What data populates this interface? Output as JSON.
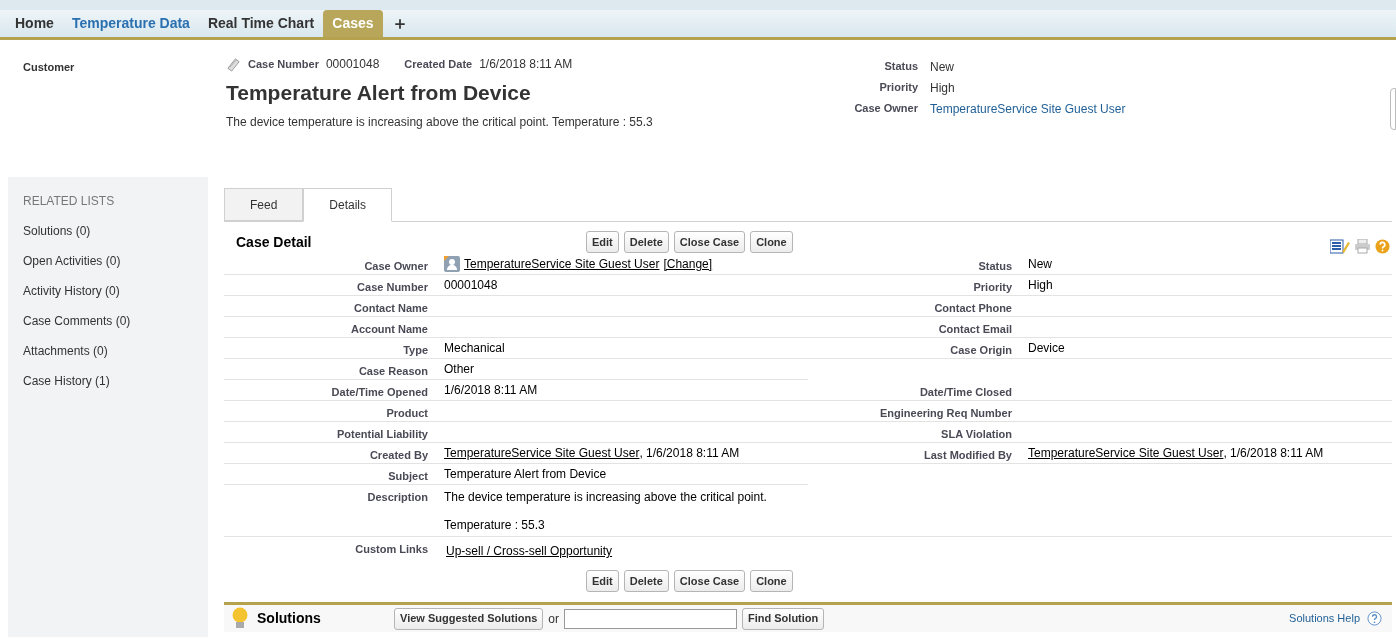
{
  "tabs": [
    {
      "kind": "text",
      "label": "Home",
      "selected": false,
      "hovered": false
    },
    {
      "kind": "text",
      "label": "Temperature Data",
      "selected": false,
      "hovered": true
    },
    {
      "kind": "text",
      "label": "Real Time Chart",
      "selected": false,
      "hovered": false
    },
    {
      "kind": "text",
      "label": "Cases",
      "selected": true,
      "hovered": false
    },
    {
      "kind": "add",
      "selected": false
    }
  ],
  "header": {
    "left_label": "Customer",
    "meta": [
      {
        "label": "Case Number",
        "value": "00001048"
      },
      {
        "label": "Created Date",
        "value": "1/6/2018 8:11 AM"
      }
    ],
    "title": "Temperature Alert from Device",
    "description": "The device temperature is increasing above the critical point. Temperature : 55.3",
    "fields": [
      {
        "label": "Status",
        "value": "New",
        "link": false
      },
      {
        "label": "Priority",
        "value": "High",
        "link": false
      },
      {
        "label": "Case Owner",
        "value": "TemperatureService Site Guest User",
        "link": true
      }
    ]
  },
  "sidebar": {
    "title": "RELATED LISTS",
    "items": [
      "Solutions (0)",
      "Open Activities (0)",
      "Activity History (0)",
      "Case Comments (0)",
      "Attachments (0)",
      "Case History (1)"
    ]
  },
  "view_tabs": [
    {
      "label": "Feed",
      "selected": false
    },
    {
      "label": "Details",
      "selected": true
    }
  ],
  "detail": {
    "title": "Case Detail",
    "top_buttons": [
      "Edit",
      "Delete",
      "Close Case",
      "Clone"
    ],
    "rows": [
      {
        "left": {
          "label": "Case Owner",
          "parts": [
            {
              "kind": "avatar"
            },
            {
              "kind": "link",
              "text": "TemperatureService Site Guest User"
            },
            {
              "kind": "link",
              "text": "[Change]"
            }
          ]
        },
        "right": {
          "label": "Status",
          "parts": [
            {
              "kind": "text",
              "text": "New"
            }
          ]
        }
      },
      {
        "left": {
          "label": "Case Number",
          "parts": [
            {
              "kind": "text",
              "text": "00001048"
            }
          ]
        },
        "right": {
          "label": "Priority",
          "parts": [
            {
              "kind": "text",
              "text": "High"
            }
          ]
        }
      },
      {
        "left": {
          "label": "Contact Name"
        },
        "right": {
          "label": "Contact Phone"
        }
      },
      {
        "left": {
          "label": "Account Name"
        },
        "right": {
          "label": "Contact Email"
        }
      },
      {
        "left": {
          "label": "Type",
          "parts": [
            {
              "kind": "text",
              "text": "Mechanical"
            }
          ]
        },
        "right": {
          "label": "Case Origin",
          "parts": [
            {
              "kind": "text",
              "text": "Device"
            }
          ]
        }
      },
      {
        "left": {
          "label": "Case Reason",
          "parts": [
            {
              "kind": "text",
              "text": "Other"
            }
          ]
        }
      },
      {
        "left": {
          "label": "Date/Time Opened",
          "parts": [
            {
              "kind": "text",
              "text": "1/6/2018 8:11 AM"
            }
          ]
        },
        "right": {
          "label": "Date/Time Closed"
        }
      },
      {
        "left": {
          "label": "Product"
        },
        "right": {
          "label": "Engineering Req Number"
        }
      },
      {
        "left": {
          "label": "Potential Liability"
        },
        "right": {
          "label": "SLA Violation"
        }
      },
      {
        "left": {
          "label": "Created By",
          "parts": [
            {
              "kind": "link",
              "text": "TemperatureService Site Guest User"
            },
            {
              "kind": "text",
              "text": ", 1/6/2018 8:11 AM"
            }
          ]
        },
        "right": {
          "label": "Last Modified By",
          "parts": [
            {
              "kind": "link",
              "text": "TemperatureService Site Guest User"
            },
            {
              "kind": "text",
              "text": ", 1/6/2018 8:11 AM"
            }
          ]
        }
      },
      {
        "left": {
          "label": "Subject",
          "parts": [
            {
              "kind": "text",
              "text": "Temperature Alert from Device"
            }
          ]
        }
      }
    ],
    "description": {
      "label": "Description",
      "paragraphs": [
        "The device temperature is increasing above the critical point.",
        "Temperature : 55.3"
      ]
    },
    "custom_links": {
      "label": "Custom Links",
      "link": "Up-sell / Cross-sell Opportunity"
    },
    "bottom_buttons": [
      "Edit",
      "Delete",
      "Close Case",
      "Clone"
    ]
  },
  "solutions": {
    "title": "Solutions",
    "view_button": "View Suggested Solutions",
    "or": "or",
    "find_button": "Find Solution",
    "help": "Solutions Help"
  }
}
